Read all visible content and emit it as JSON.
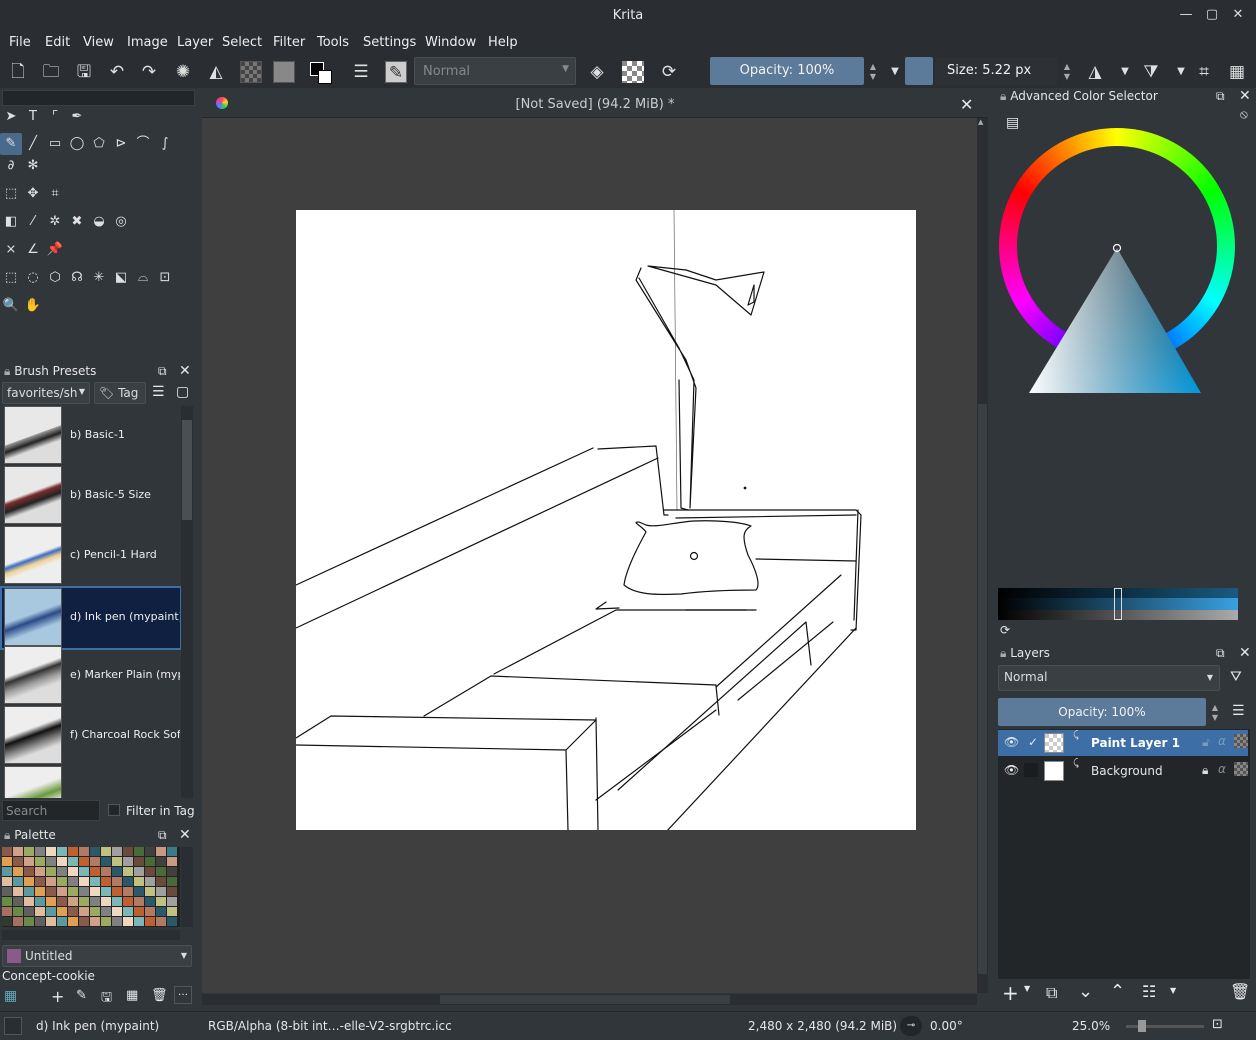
{
  "window": {
    "title": "Krita"
  },
  "menu": [
    "File",
    "Edit",
    "View",
    "Image",
    "Layer",
    "Select",
    "Filter",
    "Tools",
    "Settings",
    "Window",
    "Help"
  ],
  "toolbar": {
    "blend_mode": "Normal",
    "opacity": "Opacity: 100%",
    "size": "Size: 5.22 px"
  },
  "document": {
    "tab_title": "[Not Saved]  (94.2 MiB) *"
  },
  "brush_presets": {
    "title": "Brush Presets",
    "tag_filter": "favorites/sh",
    "tag_button": "Tag",
    "items": [
      {
        "label": "b) Basic-1"
      },
      {
        "label": "b) Basic-5 Size"
      },
      {
        "label": "c) Pencil-1 Hard"
      },
      {
        "label": "d) Ink pen (mypaint)",
        "selected": true
      },
      {
        "label": "e) Marker Plain (myp"
      },
      {
        "label": "f) Charcoal Rock Soft"
      }
    ],
    "search_placeholder": "Search",
    "filter_in_tag": "Filter in Tag"
  },
  "palette": {
    "title": "Palette",
    "name": "Untitled",
    "group": "Concept-cookie"
  },
  "color_selector": {
    "title": "Advanced Color Selector"
  },
  "layers": {
    "title": "Layers",
    "blend_mode": "Normal",
    "opacity": "Opacity:  100%",
    "items": [
      {
        "name": "Paint Layer 1",
        "active": true
      },
      {
        "name": "Background",
        "active": false
      }
    ]
  },
  "status": {
    "brush": "d) Ink pen (mypaint)",
    "color_profile": "RGB/Alpha (8-bit int…-elle-V2-srgbtrc.icc",
    "dimensions": "2,480 x 2,480 (94.2 MiB)",
    "rotation": "0.00°",
    "zoom": "25.0%"
  },
  "colors": {
    "accent": "#5c7a99",
    "selection": "#3d6ea5",
    "panel_bg": "#31363b",
    "canvas_bg": "#3f3f3f"
  }
}
